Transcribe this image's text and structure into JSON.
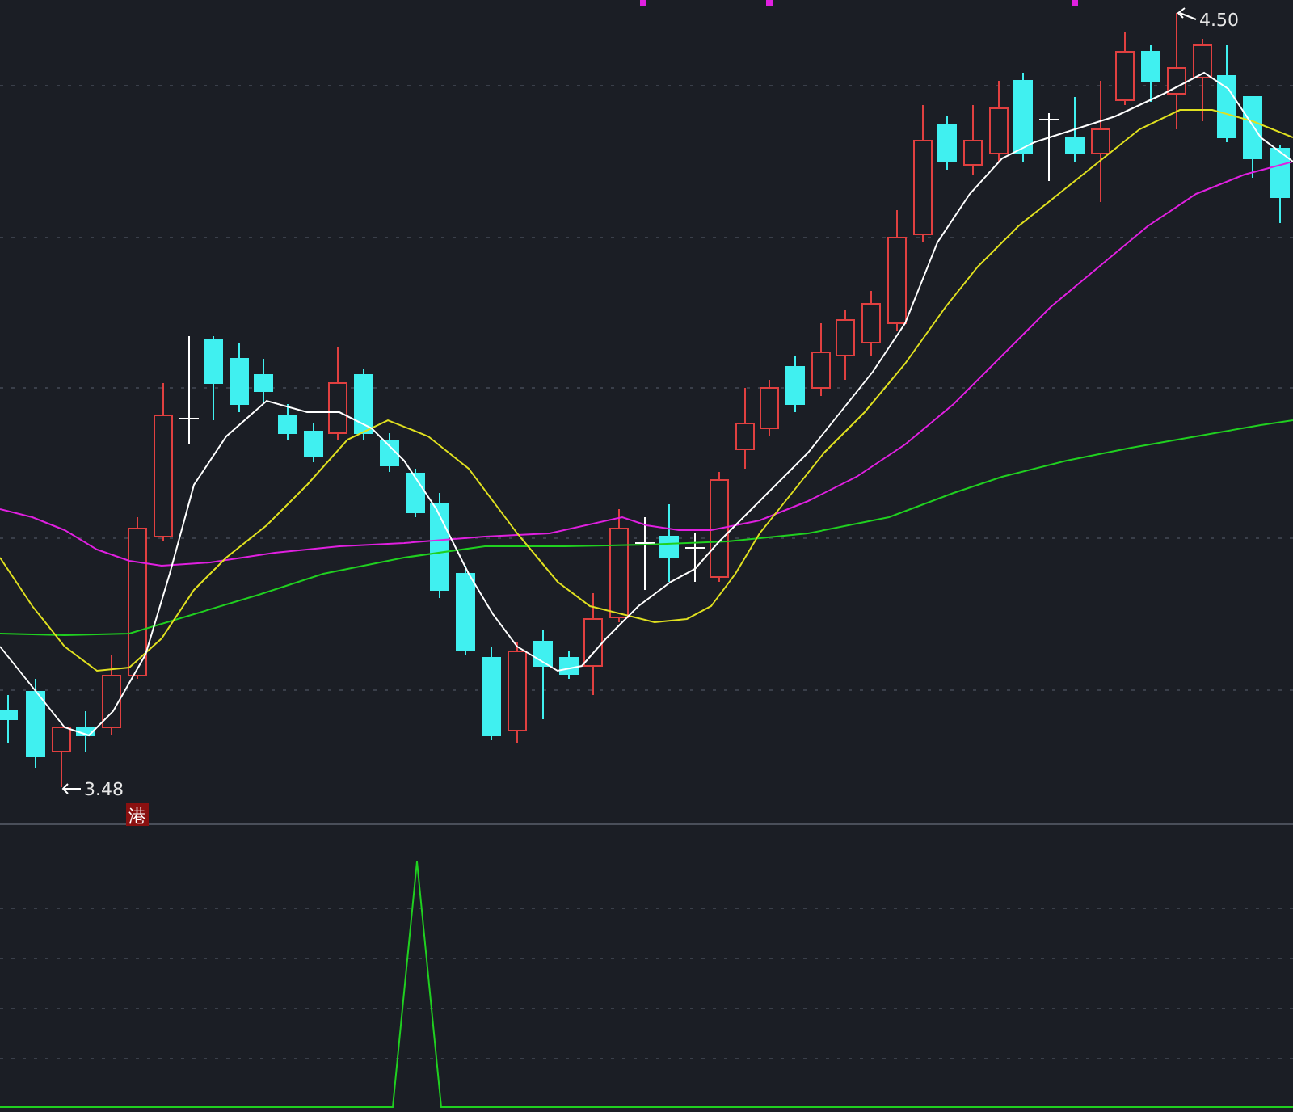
{
  "price_chart": {
    "high_label": "4.50",
    "low_label": "3.48",
    "badge": "港"
  }
}
